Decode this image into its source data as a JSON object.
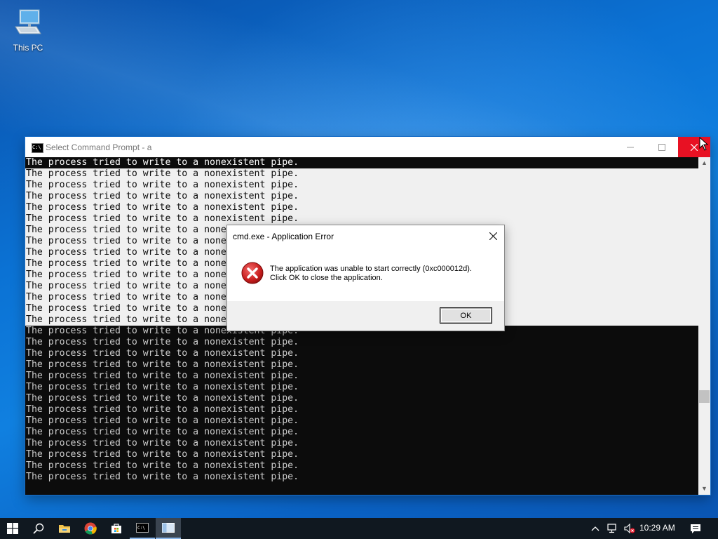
{
  "desktop": {
    "icons": [
      {
        "label": "This PC",
        "icon": "computer-icon"
      }
    ]
  },
  "cmd_window": {
    "title": "Select Command Prompt - a",
    "icon": "cmd-icon",
    "buttons": {
      "minimize": "minimize-icon",
      "maximize": "maximize-icon",
      "close": "close-icon"
    },
    "console_lines": [
      "The process tried to write to a nonexistent pipe.",
      "The process tried to write to a nonexistent pipe.",
      "The process tried to write to a nonexistent pipe.",
      "The process tried to write to a nonexistent pipe.",
      "The process tried to write to a nonexistent pipe.",
      "The process tried to write to a nonexistent pipe.",
      "The process tried to write to a nonexistent pipe.",
      "The process tried to write to a nonexistent pipe.",
      "The process tried to write to a nonexistent pipe.",
      "The process tried to write to a nonexistent pipe.",
      "The process tried to write to a nonexistent pipe.",
      "The process tried to write to a nonexistent pipe.",
      "The process tried to write to a nonexistent pipe.",
      "The process tried to write to a nonexistent pipe.",
      "The process tried to write to a nonexistent pipe.",
      "The process tried to write to a nonexistent pipe.",
      "The process tried to write to a nonexistent pipe.",
      "The process tried to write to a nonexistent pipe.",
      "The process tried to write to a nonexistent pipe.",
      "The process tried to write to a nonexistent pipe.",
      "The process tried to write to a nonexistent pipe.",
      "The process tried to write to a nonexistent pipe.",
      "The process tried to write to a nonexistent pipe.",
      "The process tried to write to a nonexistent pipe.",
      "The process tried to write to a nonexistent pipe.",
      "The process tried to write to a nonexistent pipe.",
      "The process tried to write to a nonexistent pipe.",
      "The process tried to write to a nonexistent pipe.",
      "The process tried to write to a nonexistent pipe."
    ],
    "selected_line_range": [
      1,
      14
    ],
    "colors": {
      "console_bg": "#0c0c0c",
      "console_fg": "#cccccc",
      "selection_bg": "#f0f0f0",
      "close_hover": "#e81123"
    }
  },
  "error_dialog": {
    "title": "cmd.exe - Application Error",
    "icon": "error-icon",
    "message_line1": "The application was unable to start correctly (0xc000012d).",
    "message_line2": "Click OK to close the application.",
    "ok_label": "OK",
    "close_icon": "close-icon"
  },
  "taskbar": {
    "items": [
      {
        "name": "start",
        "icon": "windows-logo-icon"
      },
      {
        "name": "search",
        "icon": "search-icon"
      },
      {
        "name": "file-explorer",
        "icon": "folder-icon"
      },
      {
        "name": "chrome",
        "icon": "chrome-icon"
      },
      {
        "name": "store",
        "icon": "store-icon"
      },
      {
        "name": "command-prompt",
        "icon": "cmd-icon"
      },
      {
        "name": "app-window",
        "icon": "window-icon"
      }
    ],
    "tray": {
      "icons": [
        "chevron-up-icon",
        "network-icon",
        "volume-muted-icon"
      ],
      "time": "10:29 AM",
      "notifications_icon": "action-center-icon"
    },
    "colors": {
      "background": "#101820",
      "accent": "#8ab6ea"
    }
  }
}
